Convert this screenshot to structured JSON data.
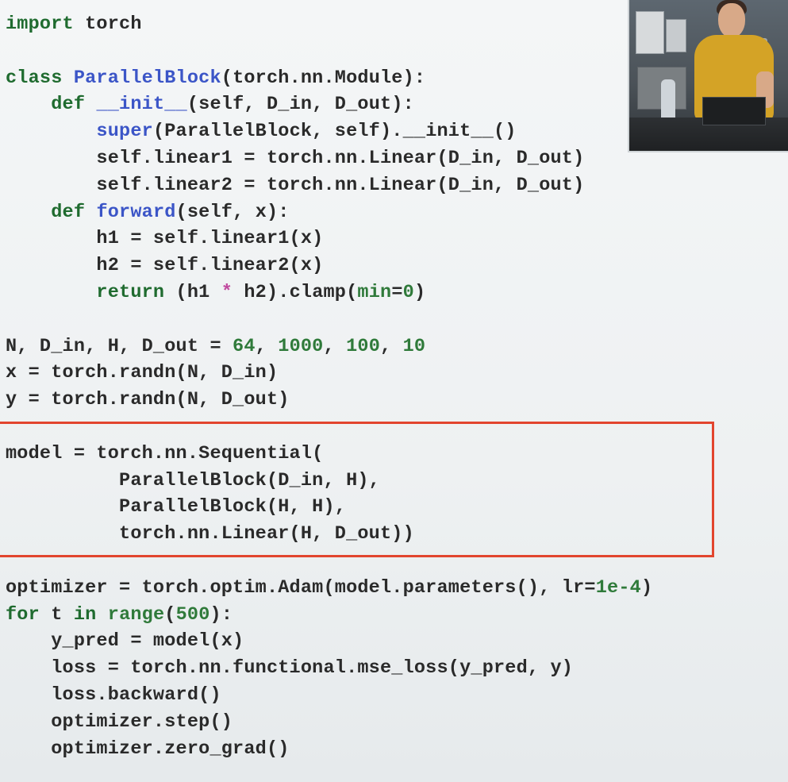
{
  "code": {
    "lines": [
      [
        {
          "t": "import",
          "c": "kw"
        },
        {
          "t": " torch",
          "c": ""
        }
      ],
      [],
      [
        {
          "t": "class",
          "c": "kw"
        },
        {
          "t": " ",
          "c": ""
        },
        {
          "t": "ParallelBlock",
          "c": "fn"
        },
        {
          "t": "(torch.nn.Module):",
          "c": ""
        }
      ],
      [
        {
          "t": "    ",
          "c": ""
        },
        {
          "t": "def",
          "c": "kw"
        },
        {
          "t": " ",
          "c": ""
        },
        {
          "t": "__init__",
          "c": "fn"
        },
        {
          "t": "(self, D_in, D_out):",
          "c": ""
        }
      ],
      [
        {
          "t": "        ",
          "c": ""
        },
        {
          "t": "super",
          "c": "fn"
        },
        {
          "t": "(ParallelBlock, self).__init__()",
          "c": ""
        }
      ],
      [
        {
          "t": "        self.linear1 = torch.nn.Linear(D_in, D_out)",
          "c": ""
        }
      ],
      [
        {
          "t": "        self.linear2 = torch.nn.Linear(D_in, D_out)",
          "c": ""
        }
      ],
      [
        {
          "t": "    ",
          "c": ""
        },
        {
          "t": "def",
          "c": "kw"
        },
        {
          "t": " ",
          "c": ""
        },
        {
          "t": "forward",
          "c": "fn"
        },
        {
          "t": "(self, x):",
          "c": ""
        }
      ],
      [
        {
          "t": "        h1 = self.linear1(x)",
          "c": ""
        }
      ],
      [
        {
          "t": "        h2 = self.linear2(x)",
          "c": ""
        }
      ],
      [
        {
          "t": "        ",
          "c": ""
        },
        {
          "t": "return",
          "c": "kw"
        },
        {
          "t": " (h1 ",
          "c": ""
        },
        {
          "t": "*",
          "c": "op"
        },
        {
          "t": " h2).clamp(",
          "c": ""
        },
        {
          "t": "min",
          "c": "num"
        },
        {
          "t": "=",
          "c": ""
        },
        {
          "t": "0",
          "c": "num"
        },
        {
          "t": ")",
          "c": ""
        }
      ],
      [],
      [
        {
          "t": "N, D_in, H, D_out = ",
          "c": ""
        },
        {
          "t": "64",
          "c": "num"
        },
        {
          "t": ", ",
          "c": ""
        },
        {
          "t": "1000",
          "c": "num"
        },
        {
          "t": ", ",
          "c": ""
        },
        {
          "t": "100",
          "c": "num"
        },
        {
          "t": ", ",
          "c": ""
        },
        {
          "t": "10",
          "c": "num"
        }
      ],
      [
        {
          "t": "x = torch.randn(N, D_in)",
          "c": ""
        }
      ],
      [
        {
          "t": "y = torch.randn(N, D_out)",
          "c": ""
        }
      ],
      [],
      [
        {
          "t": "model = torch.nn.Sequential(",
          "c": ""
        }
      ],
      [
        {
          "t": "          ParallelBlock(D_in, H),",
          "c": ""
        }
      ],
      [
        {
          "t": "          ParallelBlock(H, H),",
          "c": ""
        }
      ],
      [
        {
          "t": "          torch.nn.Linear(H, D_out))",
          "c": ""
        }
      ],
      [],
      [
        {
          "t": "optimizer = torch.optim.Adam(model.parameters(), lr=",
          "c": ""
        },
        {
          "t": "1e-4",
          "c": "num"
        },
        {
          "t": ")",
          "c": ""
        }
      ],
      [
        {
          "t": "for",
          "c": "kw"
        },
        {
          "t": " t ",
          "c": ""
        },
        {
          "t": "in",
          "c": "kw"
        },
        {
          "t": " ",
          "c": ""
        },
        {
          "t": "range",
          "c": "num"
        },
        {
          "t": "(",
          "c": ""
        },
        {
          "t": "500",
          "c": "num"
        },
        {
          "t": "):",
          "c": ""
        }
      ],
      [
        {
          "t": "    y_pred = model(x)",
          "c": ""
        }
      ],
      [
        {
          "t": "    loss = torch.nn.functional.mse_loss(y_pred, y)",
          "c": ""
        }
      ],
      [
        {
          "t": "    loss.backward()",
          "c": ""
        }
      ],
      [
        {
          "t": "    optimizer.step()",
          "c": ""
        }
      ],
      [
        {
          "t": "    optimizer.zero_grad()",
          "c": ""
        }
      ]
    ]
  },
  "colors": {
    "keyword": "#1f6b2f",
    "function": "#3b55c7",
    "number": "#2f7a3a",
    "operator": "#c04a9f",
    "highlight_box": "#e2452e"
  },
  "video_inset": {
    "icon": "presenter-video-icon"
  }
}
